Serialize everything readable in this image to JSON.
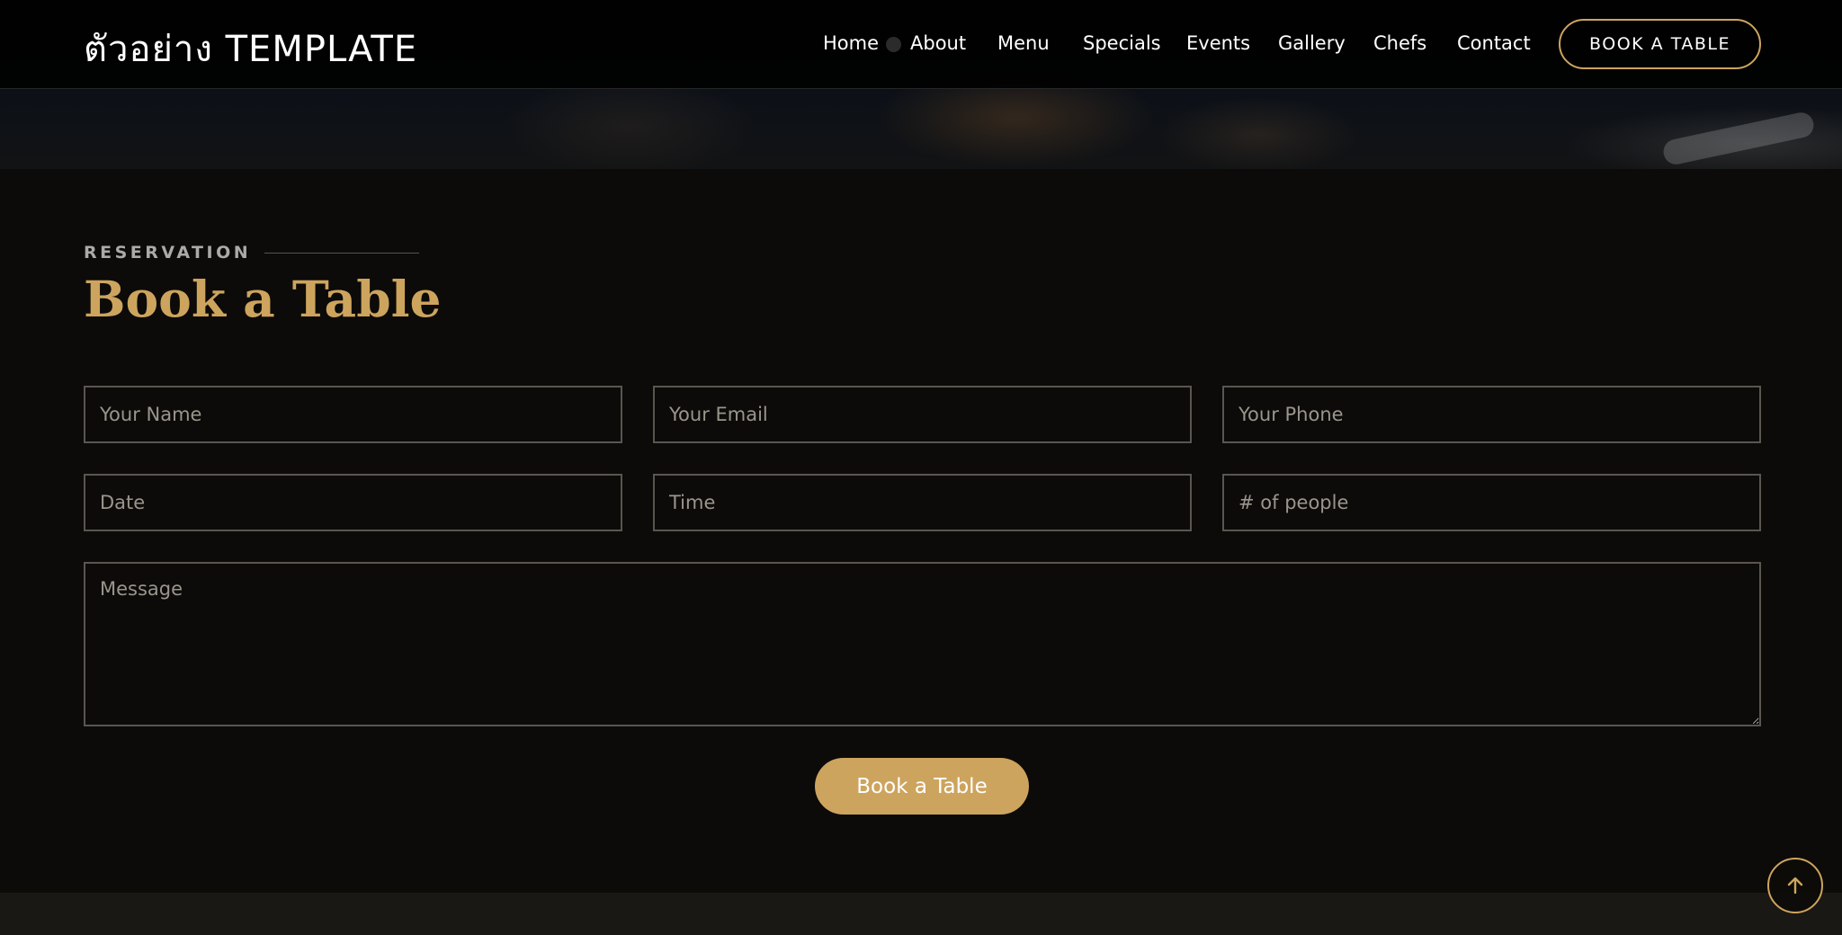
{
  "header": {
    "logo": "ตัวอย่าง TEMPLATE",
    "nav": [
      "Home",
      "About",
      "Menu",
      "Specials",
      "Events",
      "Gallery",
      "Chefs",
      "Contact"
    ],
    "book_button": "BOOK A TABLE"
  },
  "reservation": {
    "label": "RESERVATION",
    "title": "Book a Table",
    "fields": {
      "name_placeholder": "Your Name",
      "email_placeholder": "Your Email",
      "phone_placeholder": "Your Phone",
      "date_placeholder": "Date",
      "time_placeholder": "Time",
      "people_placeholder": "# of people",
      "message_placeholder": "Message"
    },
    "submit_label": "Book a Table"
  },
  "icons": {
    "scroll_top": "arrow-up-icon"
  },
  "colors": {
    "accent": "#cda45e",
    "background": "#0c0b09"
  }
}
